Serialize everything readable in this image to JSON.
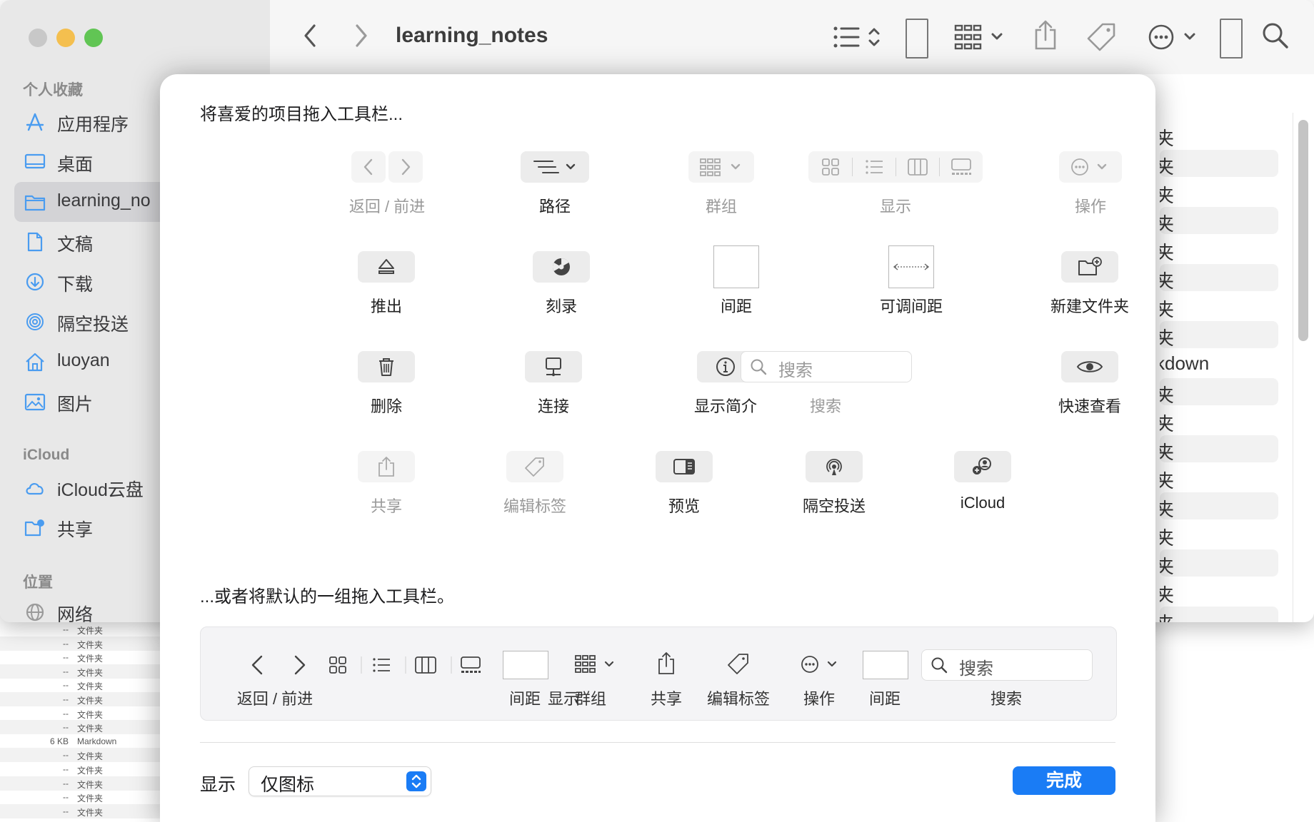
{
  "window": {
    "title": "learning_notes"
  },
  "sidebar": {
    "favorites_header": "个人收藏",
    "favorites": [
      {
        "label": "应用程序",
        "icon": "apps-icon"
      },
      {
        "label": "桌面",
        "icon": "desktop-icon"
      },
      {
        "label": "learning_no",
        "icon": "folder-icon",
        "selected": true
      },
      {
        "label": "文稿",
        "icon": "document-icon"
      },
      {
        "label": "下载",
        "icon": "download-icon"
      },
      {
        "label": "隔空投送",
        "icon": "airdrop-icon"
      },
      {
        "label": "luoyan",
        "icon": "home-icon"
      },
      {
        "label": "图片",
        "icon": "photo-icon"
      }
    ],
    "icloud_header": "iCloud",
    "icloud": [
      {
        "label": "iCloud云盘",
        "icon": "cloud-icon"
      },
      {
        "label": "共享",
        "icon": "shared-folder-icon"
      }
    ],
    "locations_header": "位置",
    "locations": [
      {
        "label": "网络",
        "icon": "network-icon"
      }
    ]
  },
  "file_list": {
    "rows": [
      "夹",
      "夹",
      "夹",
      "夹",
      "夹",
      "夹",
      "夹",
      "夹",
      "kdown",
      "夹",
      "夹",
      "夹",
      "夹",
      "夹",
      "夹",
      "夹",
      "夹",
      "夹"
    ]
  },
  "background_list": {
    "rows": [
      {
        "size": "--",
        "kind": "文件夹"
      },
      {
        "size": "--",
        "kind": "文件夹"
      },
      {
        "size": "--",
        "kind": "文件夹"
      },
      {
        "size": "--",
        "kind": "文件夹"
      },
      {
        "size": "--",
        "kind": "文件夹"
      },
      {
        "size": "--",
        "kind": "文件夹"
      },
      {
        "size": "--",
        "kind": "文件夹"
      },
      {
        "size": "--",
        "kind": "文件夹"
      },
      {
        "size": "6 KB",
        "kind": "Markdown"
      },
      {
        "size": "--",
        "kind": "文件夹"
      },
      {
        "size": "--",
        "kind": "文件夹"
      },
      {
        "size": "--",
        "kind": "文件夹"
      },
      {
        "size": "--",
        "kind": "文件夹"
      },
      {
        "size": "--",
        "kind": "文件夹"
      }
    ]
  },
  "sheet": {
    "heading_items": "将喜爱的项目拖入工具栏...",
    "heading_default": "...或者将默认的一组拖入工具栏。",
    "items": {
      "back_forward": "返回 / 前进",
      "path": "路径",
      "group": "群组",
      "view": "显示",
      "action": "操作",
      "eject": "推出",
      "burn": "刻录",
      "space": "间距",
      "flexible_space": "可调间距",
      "new_folder": "新建文件夹",
      "delete": "删除",
      "connect": "连接",
      "get_info": "显示简介",
      "search": "搜索",
      "search_placeholder": "搜索",
      "quick_look": "快速查看",
      "share": "共享",
      "edit_tags": "编辑标签",
      "preview": "预览",
      "airdrop": "隔空投送",
      "icloud": "iCloud"
    },
    "default_set": {
      "back_forward": "返回 / 前进",
      "view": "显示",
      "space1": "间距",
      "group": "群组",
      "share": "共享",
      "edit_tags": "编辑标签",
      "action": "操作",
      "space2": "间距",
      "search": "搜索",
      "search_placeholder": "搜索"
    },
    "show_label": "显示",
    "show_value": "仅图标",
    "done_label": "完成"
  },
  "colors": {
    "accent": "#1a7cf5",
    "traffic_close": "#ec6a5e",
    "traffic_min": "#f4bf4f",
    "traffic_max": "#61c554",
    "sidebar_icon": "#4a9cf0"
  }
}
